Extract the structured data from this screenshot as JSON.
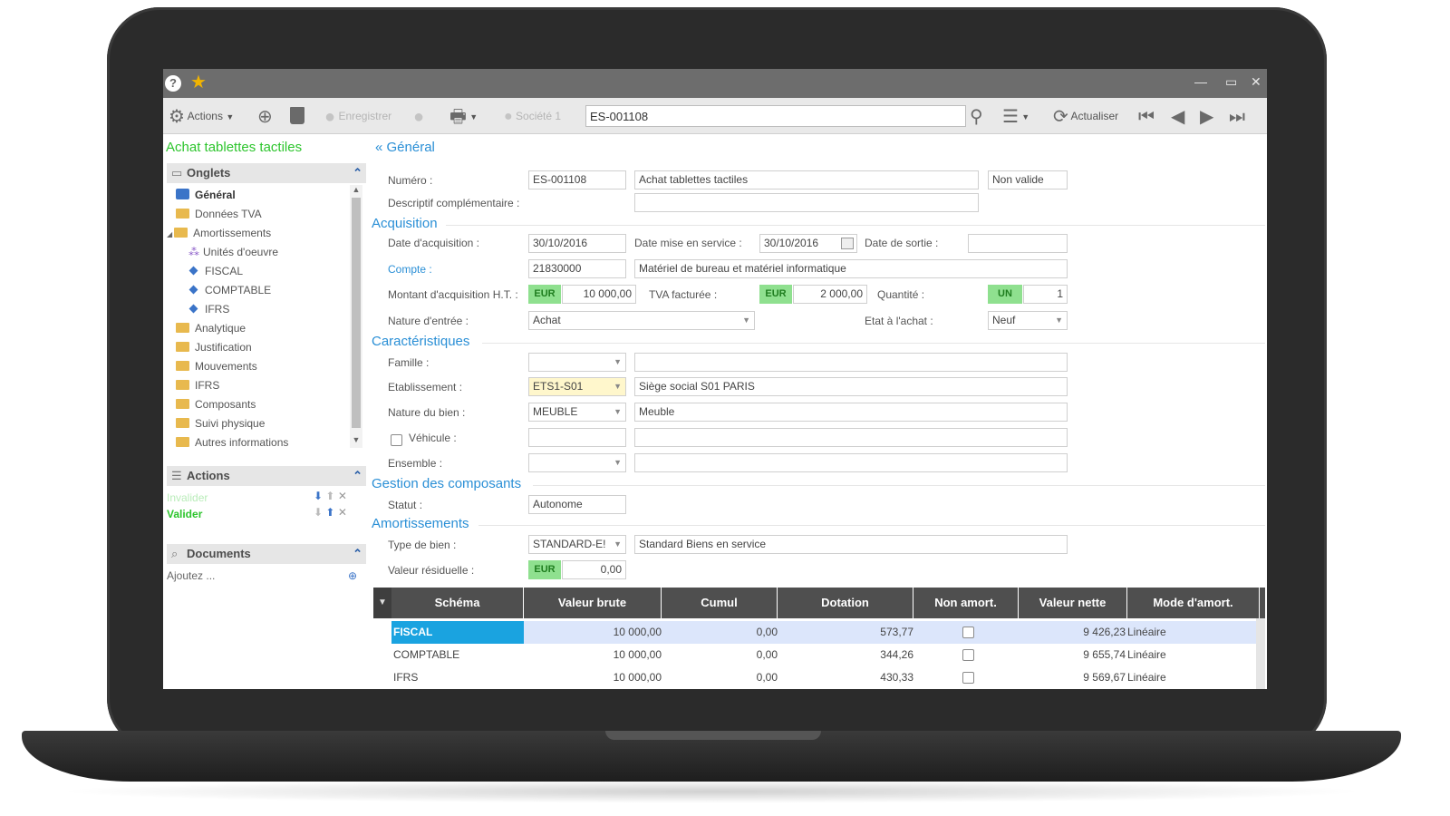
{
  "colors": {
    "accent_green": "#2dc52d",
    "section_blue": "#2a8fd6",
    "selected_row": "#1aa3e0",
    "currency_badge": "#8fe08f",
    "laptop_frame": "#2b2b2b"
  },
  "titlebar": {
    "help_icon": "?",
    "star_icon": "★",
    "minimize": "—",
    "maximize": "▭",
    "close": "✕"
  },
  "toolbar": {
    "actions_label": "Actions",
    "save_label": "Enregistrer",
    "company_label": "Société 1",
    "search_value": "ES-001108",
    "refresh_label": "Actualiser"
  },
  "left": {
    "page_title": "Achat tablettes tactiles",
    "tabs_header": "Onglets",
    "tree": [
      {
        "label": "Général"
      },
      {
        "label": "Données TVA"
      },
      {
        "label": "Amortissements"
      },
      {
        "label": "Unités d'oeuvre"
      },
      {
        "label": "FISCAL"
      },
      {
        "label": "COMPTABLE"
      },
      {
        "label": "IFRS"
      },
      {
        "label": "Analytique"
      },
      {
        "label": "Justification"
      },
      {
        "label": "Mouvements"
      },
      {
        "label": "IFRS"
      },
      {
        "label": "Composants"
      },
      {
        "label": "Suivi physique"
      },
      {
        "label": "Autres informations"
      }
    ],
    "actions_header": "Actions",
    "actions": [
      {
        "label": "Invalider"
      },
      {
        "label": "Valider"
      }
    ],
    "documents_header": "Documents",
    "documents_add": "Ajoutez ..."
  },
  "main": {
    "general": {
      "title": "Général",
      "numero_label": "Numéro :",
      "numero_value": "ES-001108",
      "libelle_value": "Achat tablettes tactiles",
      "status_value": "Non valide",
      "descriptif_label": "Descriptif complémentaire :",
      "descriptif_value": ""
    },
    "acquisition": {
      "title": "Acquisition",
      "date_acq_label": "Date d'acquisition :",
      "date_acq_value": "30/10/2016",
      "date_service_label": "Date mise en service :",
      "date_service_value": "30/10/2016",
      "date_sortie_label": "Date de sortie :",
      "date_sortie_value": "",
      "compte_label": "Compte :",
      "compte_value": "21830000",
      "compte_desc": "Matériel de bureau et matériel informatique",
      "montant_label": "Montant d'acquisition H.T. :",
      "montant_currency": "EUR",
      "montant_value": "10 000,00",
      "tva_label": "TVA facturée :",
      "tva_currency": "EUR",
      "tva_value": "2 000,00",
      "quantite_label": "Quantité :",
      "quantite_unit": "UN",
      "quantite_value": "1",
      "nature_label": "Nature d'entrée :",
      "nature_value": "Achat",
      "etat_label": "Etat à l'achat :",
      "etat_value": "Neuf"
    },
    "caracteristiques": {
      "title": "Caractéristiques",
      "famille_label": "Famille :",
      "famille_value": "",
      "famille_desc": "",
      "etab_label": "Etablissement :",
      "etab_value": "ETS1-S01",
      "etab_desc": "Siège social S01 PARIS",
      "nature_bien_label": "Nature du bien :",
      "nature_bien_value": "MEUBLE",
      "nature_bien_desc": "Meuble",
      "vehicule_label": "Véhicule :",
      "ensemble_label": "Ensemble :"
    },
    "composants": {
      "title": "Gestion des composants",
      "statut_label": "Statut :",
      "statut_value": "Autonome"
    },
    "amortissements": {
      "title": "Amortissements",
      "type_label": "Type de bien :",
      "type_value": "STANDARD-E!",
      "type_desc": "Standard Biens en service",
      "residuelle_label": "Valeur résiduelle :",
      "residuelle_currency": "EUR",
      "residuelle_value": "0,00"
    },
    "grid": {
      "columns": [
        "Schéma",
        "Valeur brute",
        "Cumul",
        "Dotation",
        "Non amort.",
        "Valeur nette",
        "Mode d'amort."
      ],
      "rows": [
        {
          "schema": "FISCAL",
          "brute": "10 000,00",
          "cumul": "0,00",
          "dotation": "573,77",
          "nette": "9 426,23",
          "mode": "Linéaire"
        },
        {
          "schema": "COMPTABLE",
          "brute": "10 000,00",
          "cumul": "0,00",
          "dotation": "344,26",
          "nette": "9 655,74",
          "mode": "Linéaire"
        },
        {
          "schema": "IFRS",
          "brute": "10 000,00",
          "cumul": "0,00",
          "dotation": "430,33",
          "nette": "9 569,67",
          "mode": "Linéaire"
        }
      ]
    }
  }
}
